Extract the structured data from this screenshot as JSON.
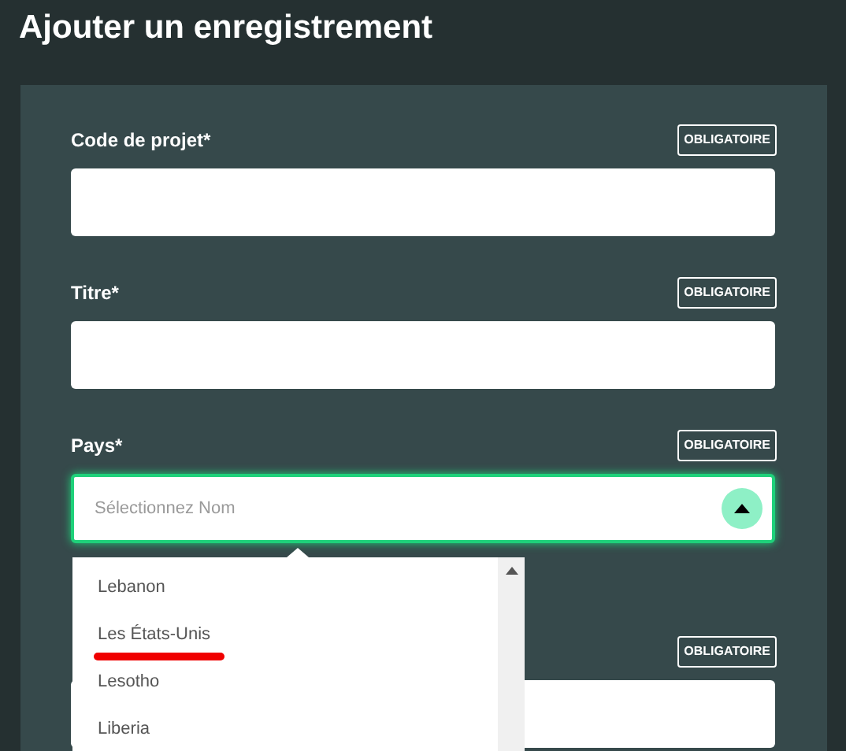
{
  "title": "Ajouter un enregistrement",
  "fields": [
    {
      "kind": "text",
      "label": "Code de projet*",
      "badge": "OBLIGATOIRE"
    },
    {
      "kind": "text",
      "label": "Titre*",
      "badge": "OBLIGATOIRE"
    },
    {
      "kind": "select",
      "label": "Pays*",
      "badge": "OBLIGATOIRE",
      "placeholder": "Sélectionnez Nom",
      "expanded": true,
      "options": [
        {
          "label": "Lebanon",
          "underlined": false
        },
        {
          "label": "Les États-Unis",
          "underlined": true
        },
        {
          "label": "Lesotho",
          "underlined": false
        },
        {
          "label": "Liberia",
          "underlined": false
        }
      ]
    },
    {
      "kind": "text",
      "badge": "OBLIGATOIRE"
    }
  ]
}
